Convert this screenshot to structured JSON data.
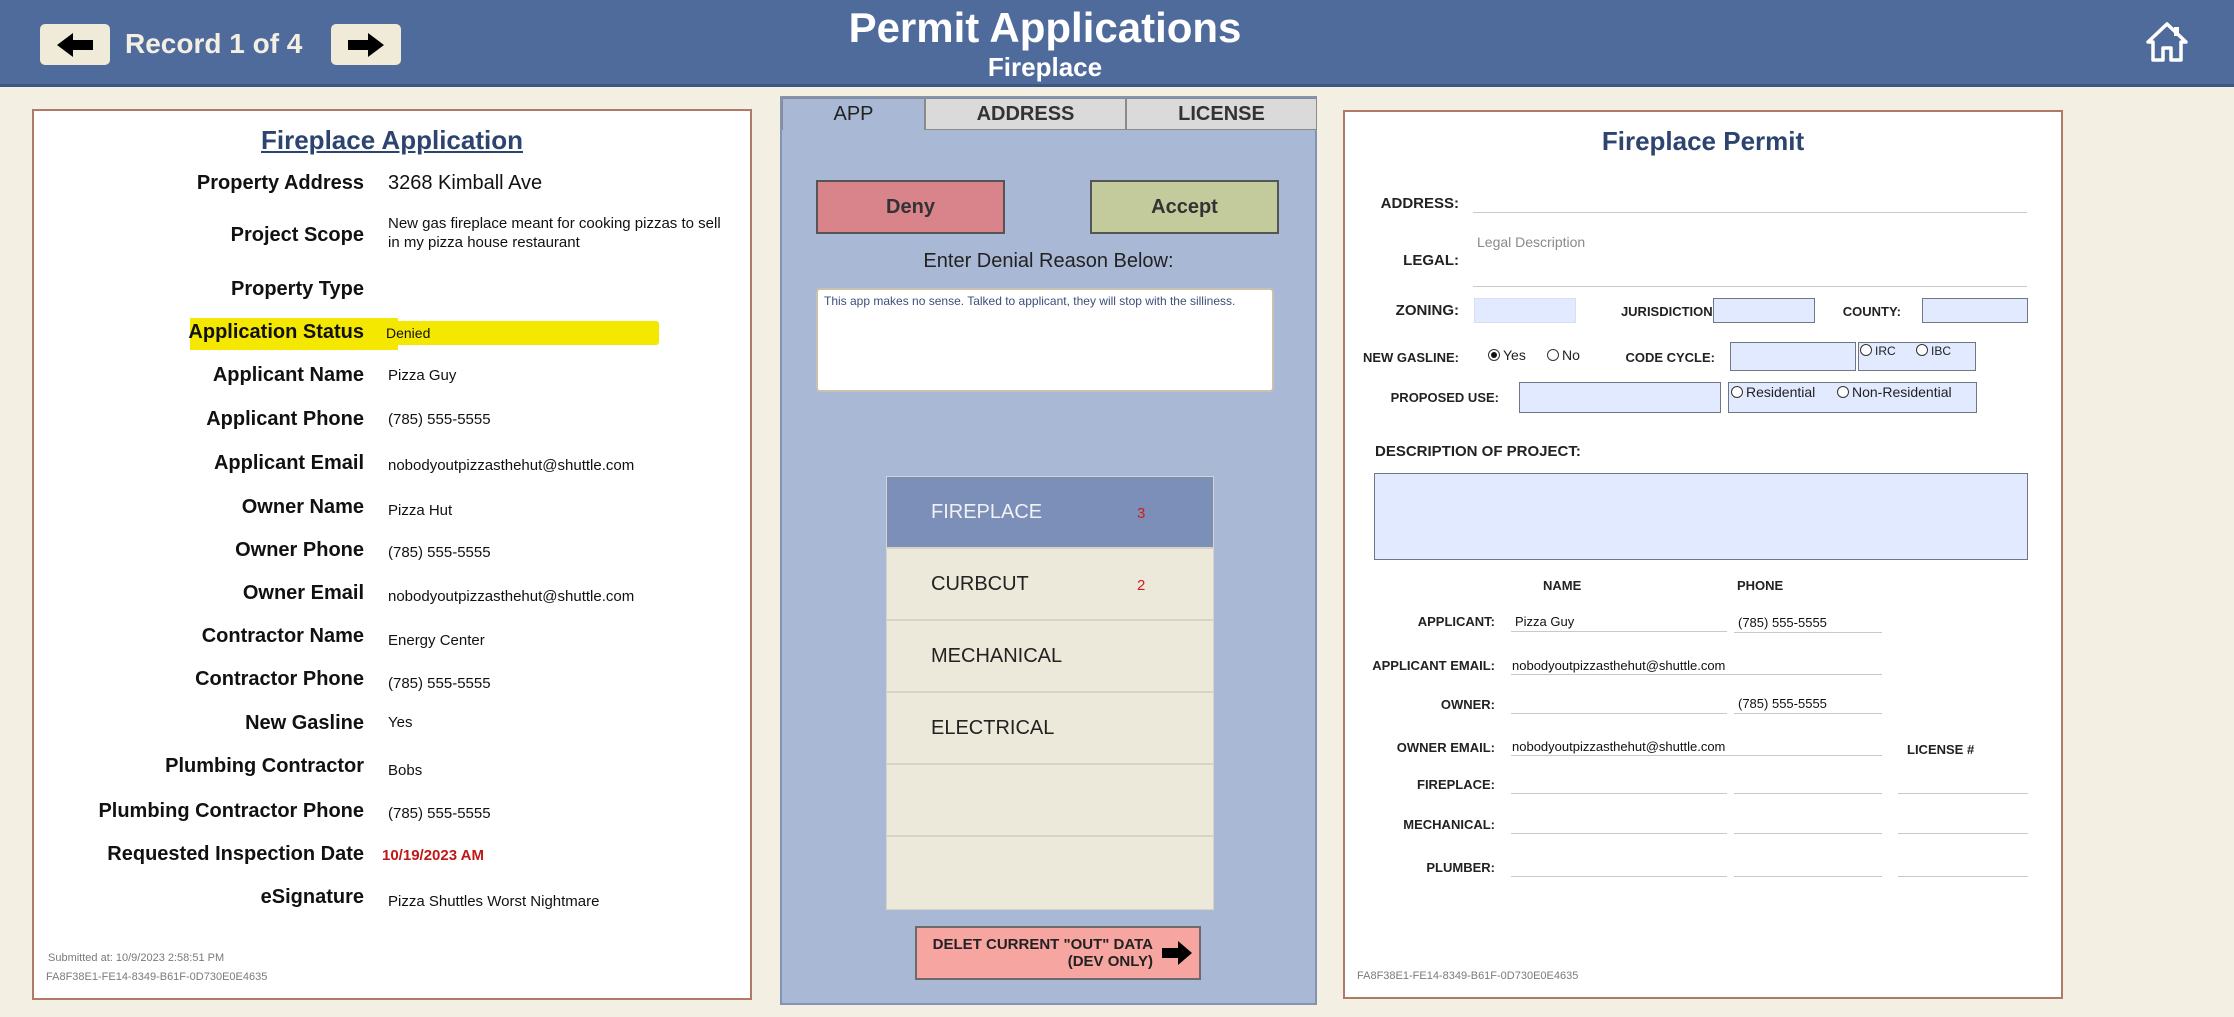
{
  "header": {
    "record_label": "Record 1 of 4",
    "title": "Permit Applications",
    "subtitle": "Fireplace"
  },
  "application": {
    "title": "Fireplace Application",
    "fields": [
      {
        "label": "Property Address",
        "value": "3268 Kimball Ave"
      },
      {
        "label": "Project Scope",
        "value": "New gas fireplace meant for cooking pizzas to sell in my pizza house restaurant"
      },
      {
        "label": "Property Type",
        "value": ""
      },
      {
        "label": "Application Status",
        "value": "Denied"
      },
      {
        "label": "Applicant Name",
        "value": "Pizza Guy"
      },
      {
        "label": "Applicant Phone",
        "value": "(785) 555-5555"
      },
      {
        "label": "Applicant Email",
        "value": "nobodyoutpizzasthehut@shuttle.com"
      },
      {
        "label": "Owner Name",
        "value": "Pizza Hut"
      },
      {
        "label": "Owner Phone",
        "value": "(785) 555-5555"
      },
      {
        "label": "Owner Email",
        "value": "nobodyoutpizzasthehut@shuttle.com"
      },
      {
        "label": "Contractor Name",
        "value": "Energy Center"
      },
      {
        "label": "Contractor Phone",
        "value": "(785) 555-5555"
      },
      {
        "label": "New Gasline",
        "value": "Yes"
      },
      {
        "label": "Plumbing Contractor",
        "value": "Bobs"
      },
      {
        "label": "Plumbing Contractor Phone",
        "value": "(785) 555-5555"
      },
      {
        "label": "Requested Inspection Date",
        "value": "10/19/2023 AM"
      },
      {
        "label": "eSignature",
        "value": "Pizza Shuttles Worst Nightmare"
      }
    ],
    "submitted": "Submitted at: 10/9/2023 2:58:51 PM",
    "record_id": "FA8F38E1-FE14-8349-B61F-0D730E0E4635"
  },
  "middle": {
    "tabs": [
      "APP",
      "ADDRESS",
      "LICENSE"
    ],
    "deny_label": "Deny",
    "accept_label": "Accept",
    "denial_prompt": "Enter Denial Reason Below:",
    "denial_text": "This app makes no sense.  Talked to applicant, they will stop with the silliness.",
    "types": [
      {
        "label": "FIREPLACE",
        "count": "3"
      },
      {
        "label": "CURBCUT",
        "count": "2"
      },
      {
        "label": "MECHANICAL",
        "count": ""
      },
      {
        "label": "ELECTRICAL",
        "count": ""
      },
      {
        "label": "",
        "count": ""
      },
      {
        "label": "",
        "count": ""
      }
    ],
    "delete_label": "DELET CURRENT \"OUT\" DATA\n(DEV ONLY)"
  },
  "permit": {
    "title": "Fireplace Permit",
    "address_label": "ADDRESS:",
    "legal_label": "LEGAL:",
    "legal_placeholder": "Legal Description",
    "zoning_label": "ZONING:",
    "jurisdiction_label": "JURISDICTION:",
    "county_label": "COUNTY:",
    "new_gasline_label": "NEW GASLINE:",
    "yes_label": "Yes",
    "no_label": "No",
    "code_cycle_label": "CODE CYCLE:",
    "irc_label": "IRC",
    "ibc_label": "IBC",
    "proposed_use_label": "PROPOSED USE:",
    "residential_label": "Residential",
    "non_residential_label": "Non-Residential",
    "description_label": "DESCRIPTION OF PROJECT:",
    "name_header": "NAME",
    "phone_header": "PHONE",
    "license_header": "LICENSE #",
    "applicant_label": "APPLICANT:",
    "applicant_name": "Pizza Guy",
    "applicant_phone": "(785) 555-5555",
    "applicant_email_label": "APPLICANT EMAIL:",
    "applicant_email": "nobodyoutpizzasthehut@shuttle.com",
    "owner_label": "OWNER:",
    "owner_phone": "(785) 555-5555",
    "owner_email_label": "OWNER EMAIL:",
    "owner_email": "nobodyoutpizzasthehut@shuttle.com",
    "fireplace_label": "FIREPLACE:",
    "mechanical_label": "MECHANICAL:",
    "plumber_label": "PLUMBER:",
    "record_id": "FA8F38E1-FE14-8349-B61F-0D730E0E4635"
  },
  "colors": {
    "header": "#4f6b9c",
    "highlight": "#f4e800",
    "deny": "#d9838b",
    "accept": "#c3cb9c",
    "active_type": "#7b8fb8"
  }
}
